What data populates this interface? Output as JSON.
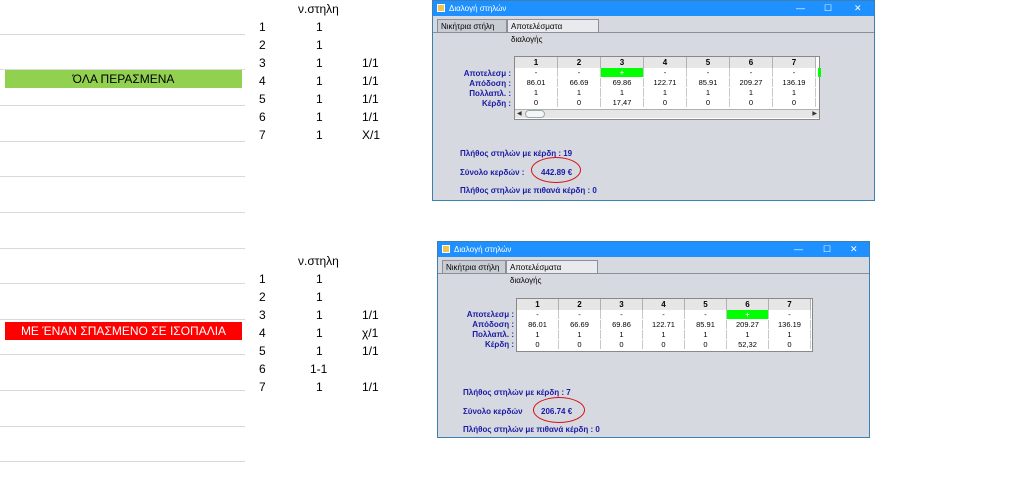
{
  "sections": [
    {
      "banner": "ΌΛΑ ΠΕΡΑΣΜΕΝΑ",
      "col_header": "ν.στηλη",
      "rows": [
        {
          "n": "1",
          "v": "1",
          "extra": ""
        },
        {
          "n": "2",
          "v": "1",
          "extra": ""
        },
        {
          "n": "3",
          "v": "1",
          "extra": "1/1"
        },
        {
          "n": "4",
          "v": "1",
          "extra": "1/1"
        },
        {
          "n": "5",
          "v": "1",
          "extra": "1/1"
        },
        {
          "n": "6",
          "v": "1",
          "extra": "1/1"
        },
        {
          "n": "7",
          "v": "1",
          "extra": "Χ/1"
        }
      ],
      "window": {
        "title": "Διαλογή στηλών",
        "tabs": [
          "Νικήτρια στήλη",
          "Αποτελέσματα διαλογής"
        ],
        "row_labels": [
          "Αποτελεσμ :",
          "Απόδοση :",
          "Πολλαπλ. :",
          "Κέρδη :"
        ],
        "columns": [
          "1",
          "2",
          "3",
          "4",
          "5",
          "6",
          "7"
        ],
        "results": [
          "-",
          "-",
          "+",
          "-",
          "-",
          "-",
          "-"
        ],
        "odds": [
          "86.01",
          "66.69",
          "69.86",
          "122.71",
          "85.91",
          "209.27",
          "136.19"
        ],
        "multipliers": [
          "1",
          "1",
          "1",
          "1",
          "1",
          "1",
          "1"
        ],
        "profits": [
          "0",
          "0",
          "17,47",
          "0",
          "0",
          "0",
          "0"
        ],
        "summary_count": "Πλήθος στηλών με κέρδη : 19",
        "summary_total_label": "Σύνολο κερδών :",
        "summary_total_value": "442.89 €",
        "summary_potential": "Πλήθος στηλών με πιθανά κέρδη : 0"
      }
    },
    {
      "banner": "ΜΕ ΈΝΑΝ ΣΠΑΣΜΕΝΟ ΣΕ ΙΣΟΠΑΛΙΑ",
      "col_header": "ν.στηλη",
      "rows": [
        {
          "n": "1",
          "v": "1",
          "extra": ""
        },
        {
          "n": "2",
          "v": "1",
          "extra": ""
        },
        {
          "n": "3",
          "v": "1",
          "extra": "1/1"
        },
        {
          "n": "4",
          "v": "1",
          "extra": "χ/1"
        },
        {
          "n": "5",
          "v": "1",
          "extra": "1/1"
        },
        {
          "n": "6",
          "v": "1-1",
          "extra": ""
        },
        {
          "n": "7",
          "v": "1",
          "extra": "1/1"
        }
      ],
      "window": {
        "title": "Διαλογή στηλών",
        "tabs": [
          "Νικήτρια στήλη",
          "Αποτελέσματα διαλογής"
        ],
        "row_labels": [
          "Αποτελεσμ :",
          "Απόδοση :",
          "Πολλαπλ. :",
          "Κέρδη :"
        ],
        "columns": [
          "1",
          "2",
          "3",
          "4",
          "5",
          "6",
          "7"
        ],
        "results": [
          "-",
          "-",
          "-",
          "-",
          "-",
          "+",
          "-"
        ],
        "odds": [
          "86.01",
          "66.69",
          "69.86",
          "122.71",
          "85.91",
          "209.27",
          "136.19"
        ],
        "multipliers": [
          "1",
          "1",
          "1",
          "1",
          "1",
          "1",
          "1"
        ],
        "profits": [
          "0",
          "0",
          "0",
          "0",
          "0",
          "52,32",
          "0"
        ],
        "summary_count": "Πλήθος στηλών με κέρδη : 7",
        "summary_total_label": "Σύνολο κερδών",
        "summary_total_value": "206.74 €",
        "summary_potential": "Πλήθος στηλών με πιθανά κέρδη : 0"
      }
    }
  ],
  "colors": {
    "green_banner": "#92d050",
    "red_banner": "#ff0000",
    "win_blue": "#1e90ff",
    "label_blue": "#1a1aa6",
    "hit_green": "#00ff00",
    "circle_red": "#d8101a"
  },
  "icons": [
    "minimize-icon",
    "maximize-icon",
    "close-icon",
    "app-icon",
    "scroll-left-icon",
    "scroll-right-icon"
  ],
  "titlebar_buttons": {
    "minimize": "—",
    "maximize": "☐",
    "close": "✕"
  }
}
